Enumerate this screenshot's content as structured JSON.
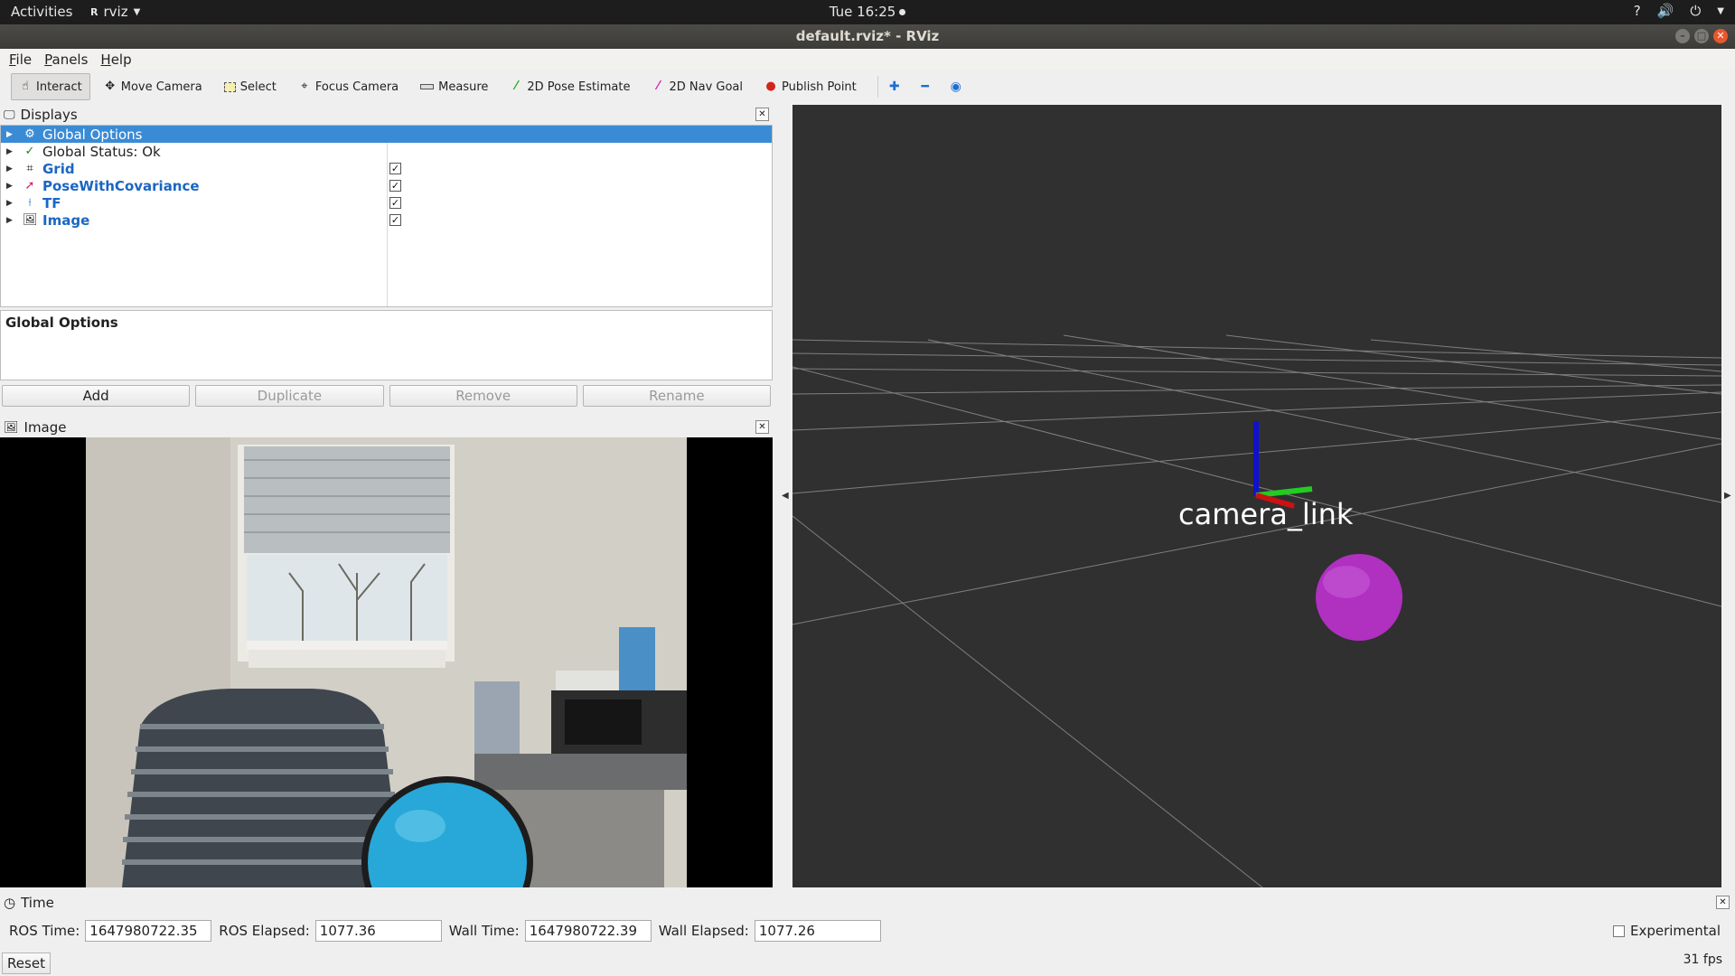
{
  "topbar": {
    "activities": "Activities",
    "app_name": "rviz",
    "app_glyph": "RViz",
    "clock": "Tue 16:25"
  },
  "window": {
    "title": "default.rviz* - RViz"
  },
  "menu": {
    "items": [
      "File",
      "Panels",
      "Help"
    ]
  },
  "toolbar": {
    "tools": [
      {
        "label": "Interact",
        "icon": "hand-icon",
        "active": true
      },
      {
        "label": "Move Camera",
        "icon": "move-camera-icon"
      },
      {
        "label": "Select",
        "icon": "select-icon"
      },
      {
        "label": "Focus Camera",
        "icon": "focus-camera-icon"
      },
      {
        "label": "Measure",
        "icon": "ruler-icon"
      },
      {
        "label": "2D Pose Estimate",
        "icon": "green-arrow-icon"
      },
      {
        "label": "2D Nav Goal",
        "icon": "pink-arrow-icon"
      },
      {
        "label": "Publish Point",
        "icon": "map-pin-icon"
      }
    ]
  },
  "displays": {
    "title": "Displays",
    "items": [
      {
        "label": "Global Options",
        "selected": true
      },
      {
        "label": "Global Status: Ok"
      },
      {
        "label": "Grid",
        "checked": true
      },
      {
        "label": "PoseWithCovariance",
        "checked": true
      },
      {
        "label": "TF",
        "checked": true
      },
      {
        "label": "Image",
        "checked": true
      }
    ],
    "description_title": "Global Options",
    "buttons": {
      "add": "Add",
      "duplicate": "Duplicate",
      "remove": "Remove",
      "rename": "Rename"
    }
  },
  "image_panel": {
    "title": "Image"
  },
  "view3d": {
    "frame_label": "camera_link",
    "colors": {
      "background": "#303030",
      "x_axis": "#cc1111",
      "y_axis": "#22cc22",
      "z_axis": "#1111cc",
      "pose": "#b030c0"
    }
  },
  "time": {
    "title": "Time",
    "ros_time_label": "ROS Time:",
    "ros_time": "1647980722.35",
    "ros_elapsed_label": "ROS Elapsed:",
    "ros_elapsed": "1077.36",
    "wall_time_label": "Wall Time:",
    "wall_time": "1647980722.39",
    "wall_elapsed_label": "Wall Elapsed:",
    "wall_elapsed": "1077.26",
    "experimental": "Experimental",
    "reset": "Reset",
    "fps": "31 fps"
  }
}
